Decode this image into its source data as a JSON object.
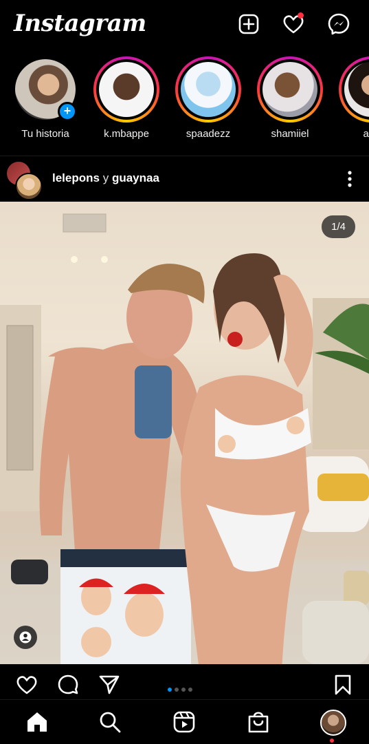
{
  "app": {
    "logo": "Instagram"
  },
  "top_actions": [
    {
      "name": "new-post",
      "icon": "plus-square-icon"
    },
    {
      "name": "activity",
      "icon": "heart-icon",
      "has_notification": true
    },
    {
      "name": "messenger",
      "icon": "messenger-icon"
    }
  ],
  "stories": [
    {
      "label": "Tu historia",
      "own": true
    },
    {
      "label": "k.mbappe"
    },
    {
      "label": "spaadezz"
    },
    {
      "label": "shamiiel"
    },
    {
      "label": "arib"
    }
  ],
  "post": {
    "user1": "lelepons",
    "joiner": "y",
    "user2": "guaynaa",
    "carousel_counter": "1/4",
    "carousel_total": 4,
    "carousel_index": 1
  },
  "colors": {
    "accent": "#0095f6",
    "notification": "#ff3040",
    "background": "#000000"
  }
}
